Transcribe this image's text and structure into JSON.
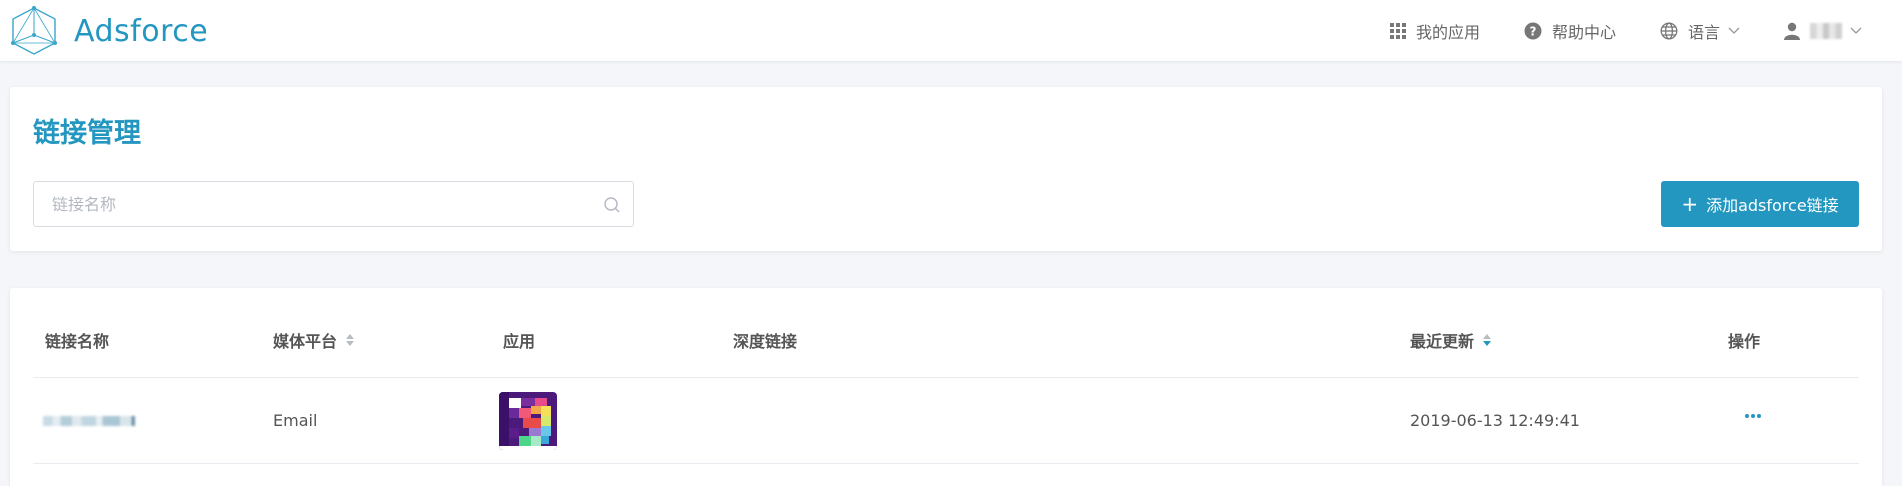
{
  "app": {
    "name": "Adsforce"
  },
  "nav": {
    "my_apps": "我的应用",
    "help": "帮助中心",
    "language": "语言"
  },
  "page": {
    "title": "链接管理",
    "search_placeholder": "链接名称",
    "add_button": "添加adsforce链接"
  },
  "table": {
    "columns": {
      "name": "链接名称",
      "platform": "媒体平台",
      "app": "应用",
      "deeplink": "深度链接",
      "updated": "最近更新",
      "actions": "操作"
    },
    "rows": [
      {
        "platform": "Email",
        "deeplink": "",
        "updated": "2019-06-13 12:49:41"
      }
    ]
  },
  "colors": {
    "accent": "#2497c1",
    "text": "#555555",
    "border": "#e8ebef"
  }
}
